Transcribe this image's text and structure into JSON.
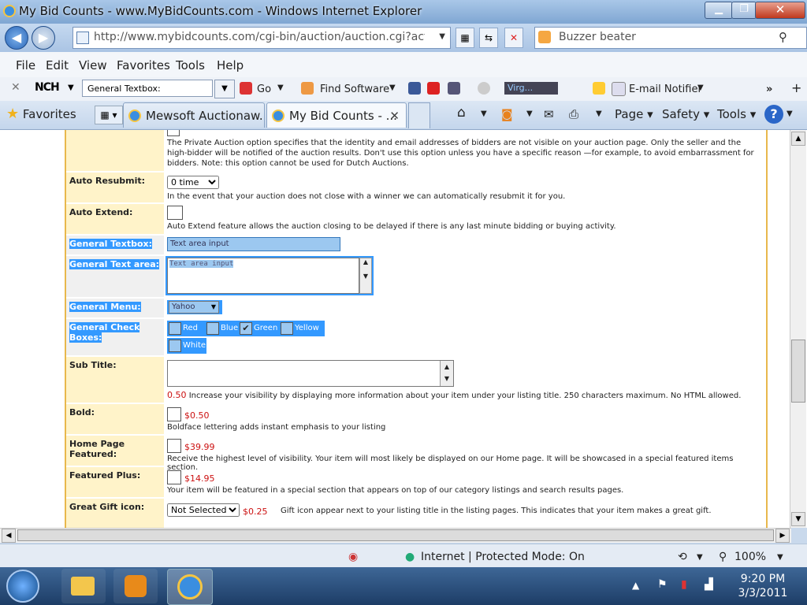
{
  "window": {
    "title": "My Bid Counts - www.MyBidCounts.com - Windows Internet Explorer",
    "min": "▁",
    "max": "❐",
    "close": "✕"
  },
  "address": {
    "url": "http://www.mybidcounts.com/cgi-bin/auction/auction.cgi?actio",
    "search_text": "Buzzer beater"
  },
  "menu": [
    "File",
    "Edit",
    "View",
    "Favorites",
    "Tools",
    "Help"
  ],
  "toolbar": {
    "nch_label": "NCH",
    "textbox_value": "General Textbox:",
    "go": "Go",
    "find_software": "Find Software",
    "virg": "Virg...",
    "email_notifier": "E-mail Notifier"
  },
  "tabs": {
    "favorites_label": "Favorites",
    "tab1": "Mewsoft Auctionaw...",
    "tab2": "My Bid Counts - ...",
    "page": "Page",
    "safety": "Safety",
    "tools": "Tools"
  },
  "form": {
    "private_desc": "The Private Auction option specifies that the identity and email addresses of bidders are not visible on your auction page. Only the seller and the high-bidder will be notified of the auction results. Don't use this option unless you have a specific reason —for example, to avoid embarrassment for bidders. Note: this option cannot be used for Dutch Auctions.",
    "auto_resubmit_label": "Auto Resubmit:",
    "auto_resubmit_value": "0 time",
    "auto_resubmit_desc": "In the event that your auction does not close with a winner we can automatically resubmit it for you.",
    "auto_extend_label": "Auto Extend:",
    "auto_extend_desc": "Auto Extend feature allows the auction closing to be delayed if there is any last minute bidding or buying activity.",
    "general_textbox_label": "General Textbox:",
    "general_textbox_value": "Text area input",
    "general_textarea_label": "General Text area:",
    "general_textarea_value": "Text area input",
    "general_menu_label": "General Menu:",
    "general_menu_value": "Yahoo",
    "general_check_label": "General Check Boxes:",
    "checkboxes": [
      "Red",
      "Blue",
      "Green",
      "Yellow",
      "White"
    ],
    "sub_title_label": "Sub Title:",
    "sub_title_price": "0.50",
    "sub_title_desc": "Increase your visibility by displaying more information about your item under your listing title. 250 characters maximum. No HTML allowed.",
    "bold_label": "Bold:",
    "bold_price": "$0.50",
    "bold_desc": "Boldface lettering adds instant emphasis to your listing",
    "home_label": "Home Page Featured:",
    "home_price": "$39.99",
    "home_desc": "Receive the highest level of visibility. Your item will most likely be displayed on our Home page. It will be showcased in a special featured items section.",
    "featured_label": "Featured Plus:",
    "featured_price": "$14.95",
    "featured_desc": "Your item will be featured in a special section that appears on top of our category listings and search results pages.",
    "gift_label": "Great Gift icon:",
    "gift_value": "Not Selected",
    "gift_price": "$0.25",
    "gift_desc": "Gift icon appear next to your listing title in the listing pages. This indicates that your item makes a great gift."
  },
  "status": {
    "zone": "Internet | Protected Mode: On",
    "zoom": "100%"
  },
  "clock": {
    "time": "9:20 PM",
    "date": "3/3/2011"
  }
}
